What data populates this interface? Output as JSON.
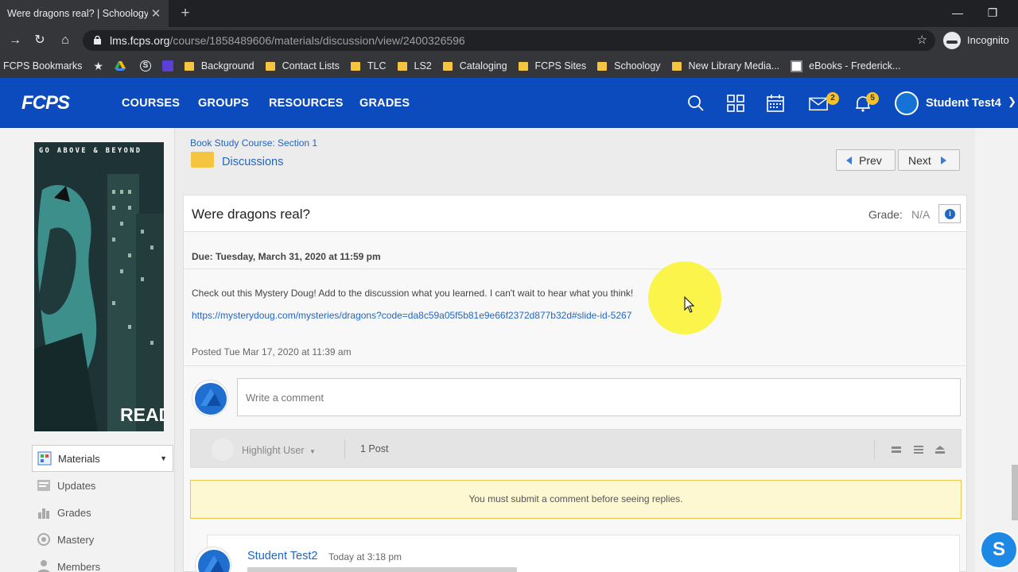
{
  "browser": {
    "tab_title": "Were dragons real? | Schoology",
    "url_host": "lms.fcps.org",
    "url_path": "/course/1858489606/materials/discussion/view/2400326596",
    "profile": "Incognito",
    "bookmarks": [
      "FCPS Bookmarks",
      "Background",
      "Contact Lists",
      "TLC",
      "LS2",
      "Cataloging",
      "FCPS Sites",
      "Schoology",
      "New Library Media...",
      "eBooks - Frederick..."
    ]
  },
  "header": {
    "logo": "FCPS",
    "nav": [
      "COURSES",
      "GROUPS",
      "RESOURCES",
      "GRADES"
    ],
    "mail_badge": "2",
    "notif_badge": "5",
    "user_name": "Student Test4"
  },
  "poster": {
    "top_text": "GO ABOVE & BEYOND",
    "bottom_text": "READ"
  },
  "sidebar": {
    "items": [
      "Materials",
      "Updates",
      "Grades",
      "Mastery",
      "Members"
    ]
  },
  "content": {
    "breadcrumb": "Book Study Course: Section 1",
    "folder_title": "Discussions",
    "prev_label": "Prev",
    "next_label": "Next",
    "post_title": "Were dragons real?",
    "grade_label": "Grade:",
    "grade_value": "N/A",
    "due": "Due: Tuesday, March 31, 2020 at 11:59 pm",
    "body": "Check out this Mystery Doug! Add to the discussion what you learned. I can't wait to hear what you think!",
    "link": "https://mysterydoug.com/mysteries/dragons?code=da8c59a05f5b81e9e66f2372d877b32d#slide-id-5267",
    "posted": "Posted Tue Mar 17, 2020 at 11:39 am",
    "comment_placeholder": "Write a comment",
    "highlight_user": "Highlight User",
    "post_count": "1 Post",
    "notice": "You must submit a comment before seeing replies.",
    "reply_user": "Student Test2",
    "reply_time": "Today at 3:18 pm"
  },
  "colors": {
    "header_blue": "#0b4bbd",
    "link_blue": "#2066c4",
    "badge_yellow": "#f4c12b",
    "notice_bg": "#fdf7d2"
  },
  "fab_label": "S"
}
